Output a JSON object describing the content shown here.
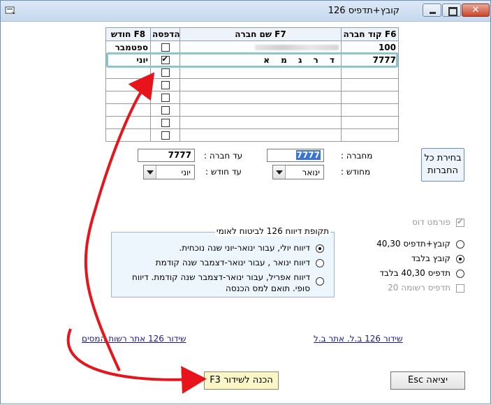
{
  "window": {
    "title": "קובץ+תדפיס 126"
  },
  "grid": {
    "headers": {
      "code": "קוד חברה F6",
      "name": "שם חברה F7",
      "print": "הדפסה",
      "month": "חודש F8"
    },
    "rows": [
      {
        "code": "100",
        "name": "",
        "print": false,
        "month": "ספטמבר",
        "blurred": true
      },
      {
        "code": "7777",
        "name": "ד ר ג מ א",
        "print": true,
        "month": "יוני"
      },
      {
        "code": "",
        "name": "",
        "print": false,
        "month": ""
      },
      {
        "code": "",
        "name": "",
        "print": false,
        "month": ""
      },
      {
        "code": "",
        "name": "",
        "print": false,
        "month": ""
      },
      {
        "code": "",
        "name": "",
        "print": false,
        "month": ""
      },
      {
        "code": "",
        "name": "",
        "print": false,
        "month": ""
      },
      {
        "code": "",
        "name": "",
        "print": false,
        "month": ""
      }
    ]
  },
  "filters": {
    "from_company_label": "מחברה :",
    "from_company_value": "7777",
    "to_company_label": "עד חברה :",
    "to_company_value": "7777",
    "from_month_label": "מחודש :",
    "from_month_value": "ינואר",
    "to_month_label": "עד חודש :",
    "to_month_value": "יוני",
    "all_companies_button": "בחירת כל החברות"
  },
  "dos_format": {
    "label": "פורמט דוס",
    "checked": true
  },
  "period_group": {
    "legend": "תקופת דיווח 126 לביטוח לאומי",
    "options": [
      {
        "label": "דיווח יולי, עבור ינואר-יוני שנה נוכחית.",
        "selected": true
      },
      {
        "label": "דיווח ינואר , עבור ינואר-דצמבר שנה קודמת",
        "selected": false
      },
      {
        "label": "דיווח אפריל, עבור ינואר-דצמבר שנה קודמת. דיווח סופי. תואם למס הכנסה",
        "selected": false
      }
    ]
  },
  "output_options": [
    {
      "label": "קובץ+תדפיס 40,30",
      "selected": false
    },
    {
      "label": "קובץ בלבד",
      "selected": true
    },
    {
      "label": "תדפיס 40,30 בלבד",
      "selected": false
    }
  ],
  "print_list20": {
    "label": "תדפיס רשומה 20",
    "checked": false
  },
  "links": {
    "tax_site": "שידור 126 אתר רשות המסים",
    "bl_site": "שידור 126 ב.ל. אתר ב.ל"
  },
  "buttons": {
    "prepare": "הכנה לשידור F3",
    "exit": "יציאה Esc"
  },
  "colors": {
    "highlight": "#8cc4d1",
    "arrow": "#e8141b",
    "prepare_bg": "#fbf6c8"
  }
}
